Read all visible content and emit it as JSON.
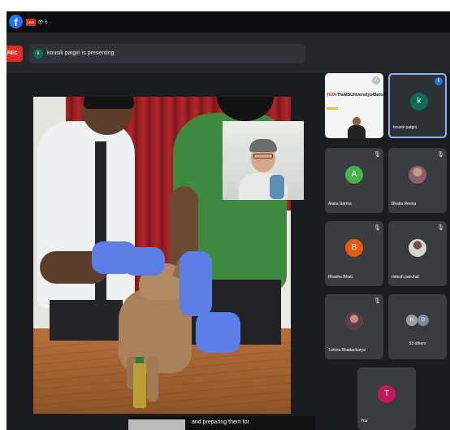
{
  "live_bar": {
    "live_label": "LIVE",
    "viewer_count": "6"
  },
  "meeting": {
    "rec_label": "REC",
    "presenter_initial": "k",
    "presenting_text": "kousik patgiri is presenting",
    "caption_text": "and preparing them for"
  },
  "participants": {
    "ted": {
      "logo_main": "TEDx",
      "logo_rest": "TheMSUniversityofBaroda",
      "badge": "A"
    },
    "kousik": {
      "initial": "k",
      "name": "kousik patgiri",
      "avatar_color": "#0d6b58"
    },
    "alaka": {
      "initial": "A",
      "name": "Alaka Sarma",
      "avatar_color": "#4caf50"
    },
    "bhatla": {
      "name": "Bhatla Reena"
    },
    "bhasha": {
      "initial": "B",
      "name": "Bhasha Bhatt",
      "avatar_color": "#e8590c"
    },
    "mitesh": {
      "name": "mitesh panchal"
    },
    "tuhina": {
      "name": "Tuhina Bhattacharya"
    },
    "others": {
      "avatar1": "N",
      "avatar2": "D",
      "label": "53 others"
    },
    "you": {
      "initial": "T",
      "name": "You",
      "avatar_color": "#c2185b"
    }
  },
  "icons": {
    "mic_off": "🎙",
    "speaking": "⦀"
  }
}
